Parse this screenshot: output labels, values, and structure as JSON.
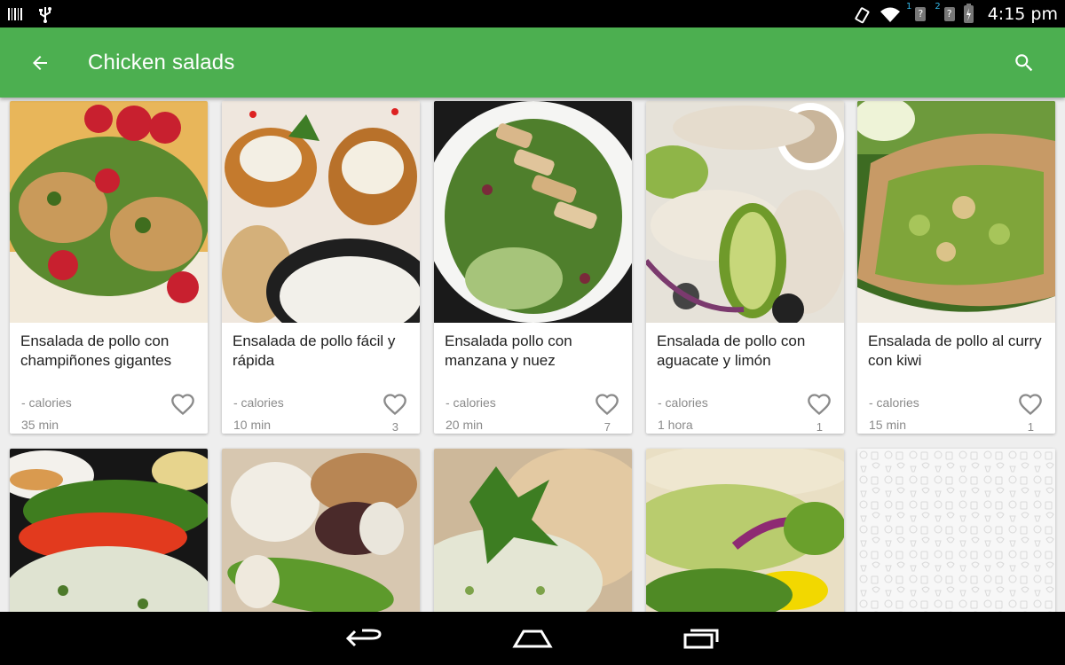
{
  "status_bar": {
    "time": "4:15 pm",
    "sim1": "1",
    "sim2": "2",
    "sim_unknown": "?",
    "icons": [
      "barcode-icon",
      "usb-icon",
      "rotation-icon",
      "wifi-icon",
      "battery-charging-icon"
    ]
  },
  "app_bar": {
    "title": "Chicken salads",
    "back_icon": "arrow-back-icon",
    "search_icon": "search-icon",
    "color": "#4caf50"
  },
  "recipes": [
    {
      "name": "Ensalada de pollo con champiñones gigantes",
      "calories": "- calories",
      "time": "35 min",
      "likes": ""
    },
    {
      "name": "Ensalada de pollo fácil y rápida",
      "calories": "- calories",
      "time": "10 min",
      "likes": "3"
    },
    {
      "name": "Ensalada pollo con manzana y nuez",
      "calories": "- calories",
      "time": "20 min",
      "likes": "7"
    },
    {
      "name": "Ensalada de pollo con aguacate y limón",
      "calories": "- calories",
      "time": "1 hora",
      "likes": "1"
    },
    {
      "name": "Ensalada de pollo al curry con kiwi",
      "calories": "- calories",
      "time": "15 min",
      "likes": "1"
    }
  ],
  "nav_bar": {
    "icons": [
      "back-nav-icon",
      "home-nav-icon",
      "recents-nav-icon"
    ]
  }
}
